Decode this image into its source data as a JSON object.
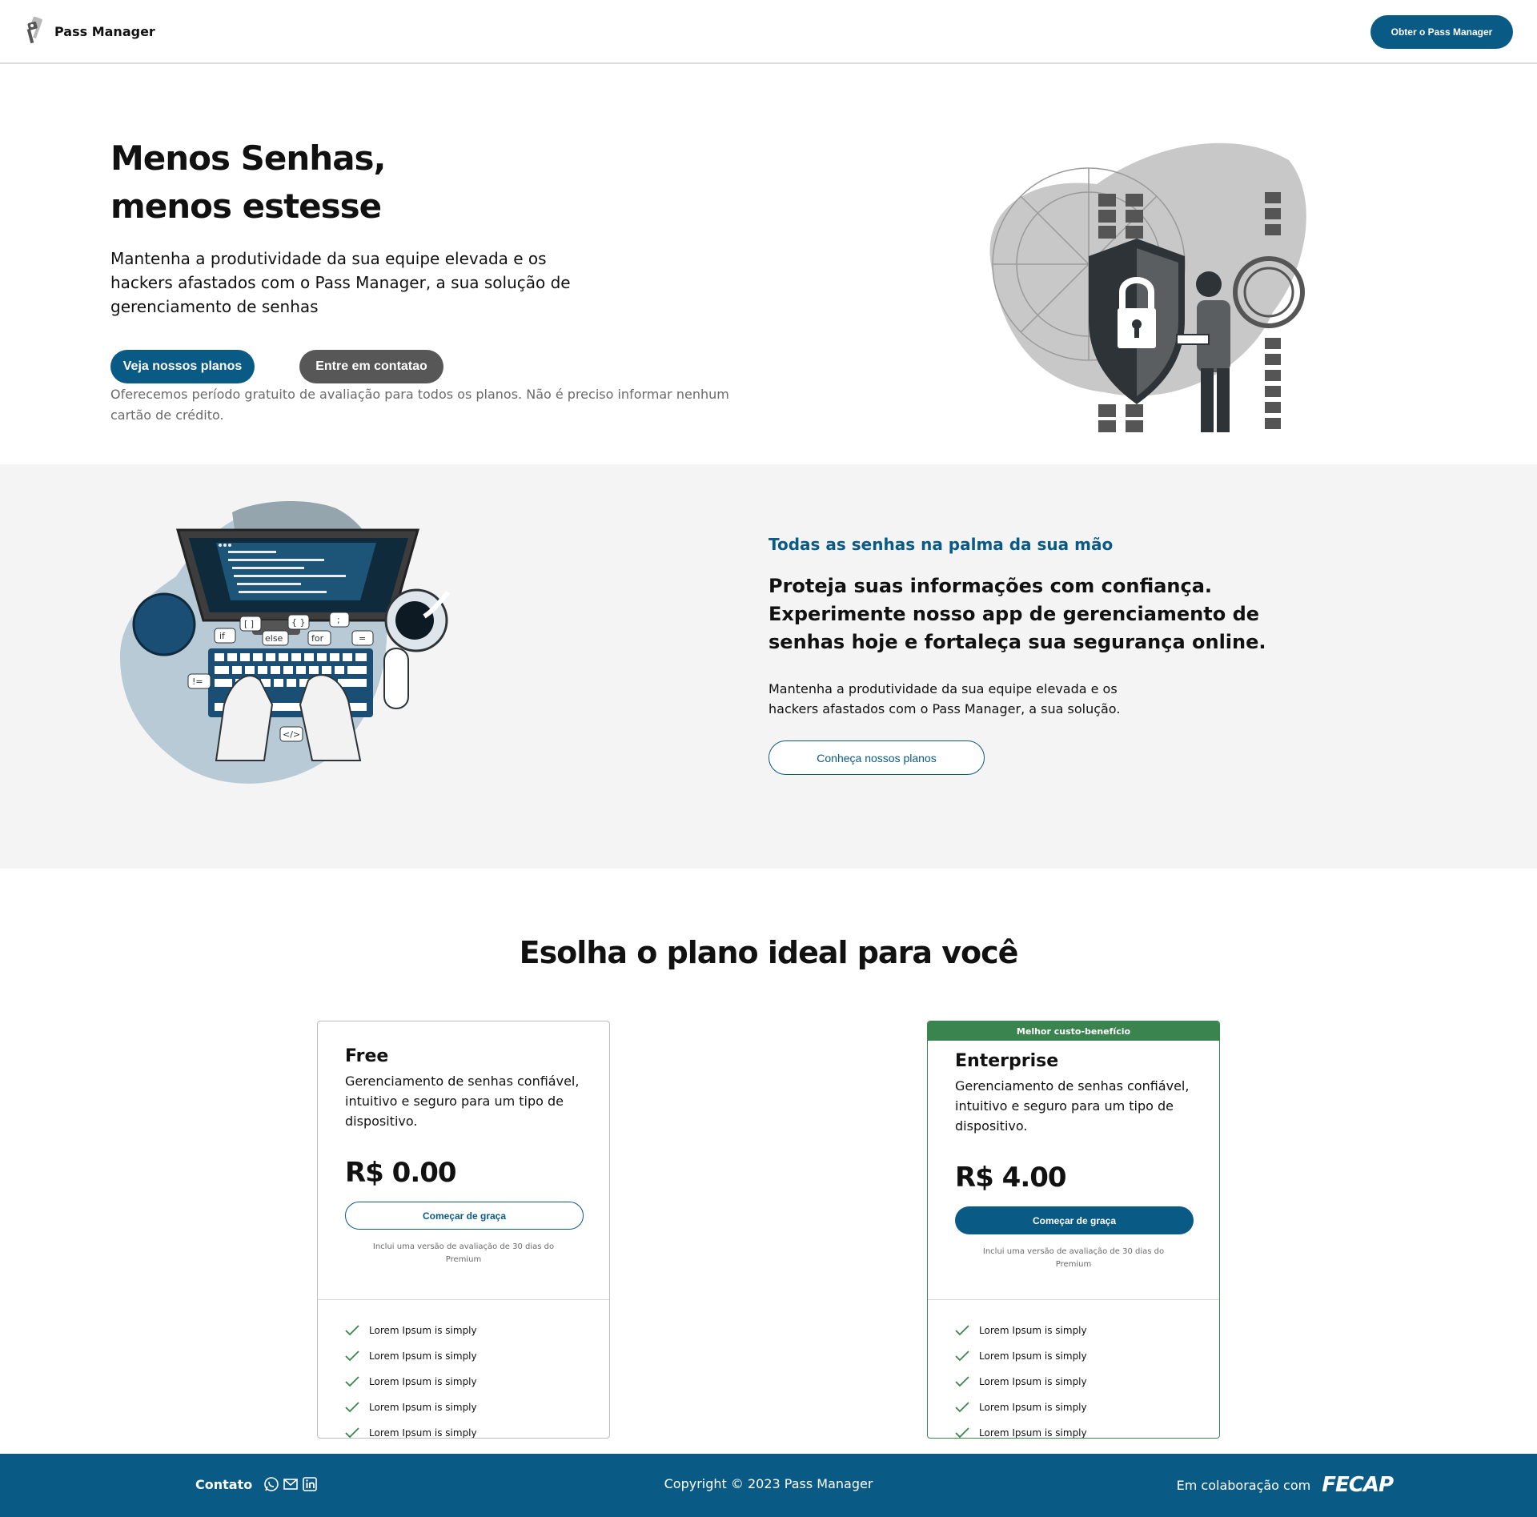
{
  "header": {
    "brand_name": "Pass Manager",
    "cta_label": "Obter o Pass Manager"
  },
  "hero": {
    "title_line1": "Menos Senhas,",
    "title_line2": "menos estesse",
    "description": "Mantenha a produtividade da sua equipe elevada e os hackers afastados com o Pass Manager, a sua solução de gerenciamento de senhas",
    "primary_button": "Veja nossos planos",
    "secondary_button": "Entre em contatao",
    "note": "Oferecemos período gratuito de avaliação para todos os planos. Não é preciso informar nenhum cartão de crédito."
  },
  "feature": {
    "eyebrow": "Todas as senhas na palma da sua mão",
    "title": "Proteja suas informações com confiança. Experimente nosso app de gerenciamento de senhas hoje e fortaleça sua segurança online.",
    "description": "Mantenha a produtividade da sua equipe elevada e os hackers afastados com o Pass Manager, a sua solução.",
    "button": "Conheça nossos planos",
    "code_tokens": [
      "if",
      "[ ]",
      "else",
      "{ }",
      "for",
      ";",
      "=",
      "!=",
      "</>"
    ]
  },
  "plans": {
    "title": "Esolha o plano ideal para você",
    "cards": [
      {
        "badge": "",
        "name": "Free",
        "description": "Gerenciamento de senhas confiável, intuitivo e seguro para um tipo de dispositivo.",
        "price": "R$ 0.00",
        "button": "Começar de graça",
        "note": "Inclui uma versão de avaliação de 30 dias do Premium",
        "features": [
          "Lorem Ipsum is simply",
          "Lorem Ipsum is simply",
          "Lorem Ipsum is simply",
          "Lorem Ipsum is simply",
          "Lorem Ipsum is simply"
        ]
      },
      {
        "badge": "Melhor custo-benefício",
        "name": "Enterprise",
        "description": "Gerenciamento de senhas confiável, intuitivo e seguro para um tipo de dispositivo.",
        "price": "R$ 4.00",
        "button": "Começar de graça",
        "note": "Inclui uma versão de avaliação de 30 dias do Premium",
        "features": [
          "Lorem Ipsum is simply",
          "Lorem Ipsum is simply",
          "Lorem Ipsum is simply",
          "Lorem Ipsum is simply",
          "Lorem Ipsum is simply"
        ]
      }
    ]
  },
  "footer": {
    "contact_label": "Contato",
    "social_icons": [
      "whatsapp-icon",
      "mail-icon",
      "linkedin-icon"
    ],
    "copyright": "Copyright © 2023 Pass Manager",
    "collab_label": "Em colaboração com",
    "partner_logo_text": "FECAP"
  },
  "colors": {
    "primary": "#0a5a86",
    "secondary_button": "#575757",
    "success": "#3a8450",
    "section_bg": "#f4f4f4"
  }
}
